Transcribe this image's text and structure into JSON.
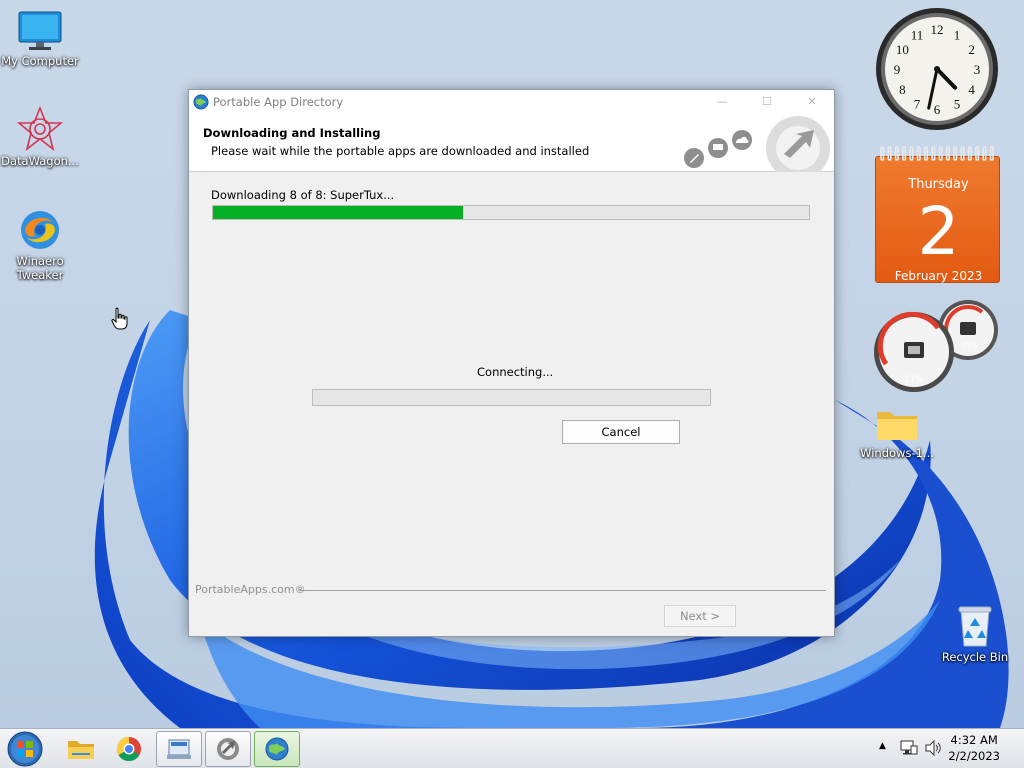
{
  "desktop": {
    "icons": [
      {
        "label": "My Computer"
      },
      {
        "label": "DataWagon..."
      },
      {
        "label": "Winaero Tweaker"
      },
      {
        "label": "Windows-1..."
      },
      {
        "label": "Recycle Bin"
      }
    ]
  },
  "window": {
    "title": "Portable App Directory",
    "header_title": "Downloading and Installing",
    "header_subtitle": "Please wait while the portable apps are downloaded and installed",
    "status_text": "Downloading 8 of 8: SuperTux...",
    "overall_progress": 0.42,
    "connecting_text": "Connecting...",
    "item_progress": 0.0,
    "cancel_label": "Cancel",
    "brand": "PortableApps.com®",
    "next_label": "Next >"
  },
  "gadgets": {
    "clock": {
      "numbers": [
        "12",
        "1",
        "2",
        "3",
        "4",
        "5",
        "6",
        "7",
        "8",
        "9",
        "10",
        "11"
      ],
      "time": "4:32"
    },
    "calendar": {
      "day": "Thursday",
      "date": "2",
      "month": "February 2023"
    },
    "meter": {
      "cpu": "17%",
      "ram": "25%"
    }
  },
  "taskbar": {
    "time": "4:32 AM",
    "date": "2/2/2023"
  },
  "colors": {
    "progress": "#06b025",
    "calendar": "#e8641c",
    "accent": "#1f64d6"
  }
}
